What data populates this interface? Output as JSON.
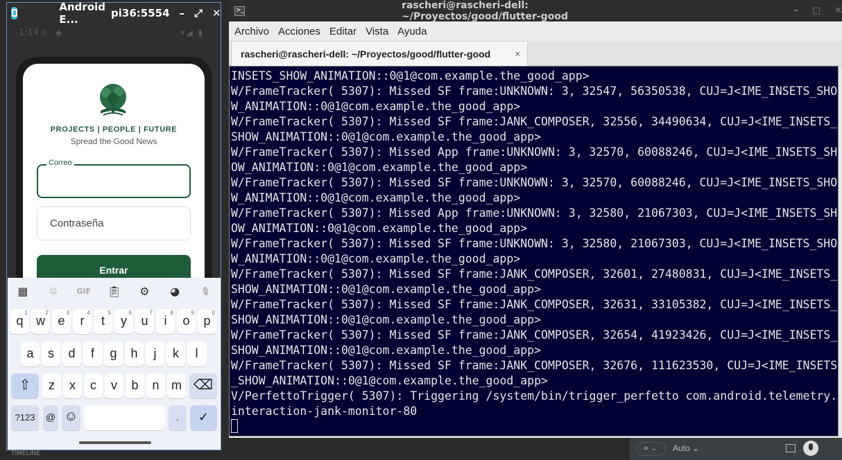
{
  "emulator": {
    "title": "Android E...",
    "device": "pi36:5554",
    "controls": {
      "minimize": "–",
      "expand": "⤢",
      "close": "✕"
    },
    "status_time": "1:14",
    "status_icons": "⊘ ◆",
    "status_right": "▾◢ ▮"
  },
  "app": {
    "slogan": "PROJECTS | PEOPLE | FUTURE",
    "tagline": "Spread the Good News",
    "email_label": "Correo",
    "email_value": "",
    "password_placeholder": "Contraseña",
    "login_button": "Entrar",
    "brand_color": "#1e5c3a"
  },
  "keyboard": {
    "toolbar": [
      "apps-icon",
      "sticker-icon",
      "GIF",
      "clipboard-icon",
      "gear-icon",
      "palette-icon",
      "mic-icon"
    ],
    "gif_label": "GIF",
    "row1": [
      {
        "k": "q",
        "h": "1"
      },
      {
        "k": "w",
        "h": "2"
      },
      {
        "k": "e",
        "h": "3"
      },
      {
        "k": "r",
        "h": "4"
      },
      {
        "k": "t",
        "h": "5"
      },
      {
        "k": "y",
        "h": "6"
      },
      {
        "k": "u",
        "h": "7"
      },
      {
        "k": "i",
        "h": "8"
      },
      {
        "k": "o",
        "h": "9"
      },
      {
        "k": "p",
        "h": "0"
      }
    ],
    "row2": [
      "a",
      "s",
      "d",
      "f",
      "g",
      "h",
      "j",
      "k",
      "l"
    ],
    "row3": [
      "z",
      "x",
      "c",
      "v",
      "b",
      "n",
      "m"
    ],
    "shift": "⇧",
    "backspace": "⌫",
    "symbols": "?123",
    "at": "@",
    "emoji": "☺",
    "period": ".",
    "enter": "✓"
  },
  "timeline_label": "TIMELINE",
  "terminal": {
    "title": "rascheri@rascheri-dell: ~/Proyectos/good/flutter-good",
    "window_controls": [
      "–",
      "□",
      "✕"
    ],
    "menu": [
      "Archivo",
      "Acciones",
      "Editar",
      "Vista",
      "Ayuda"
    ],
    "tab_label": "rascheri@rascheri-dell: ~/Proyectos/good/flutter-good",
    "tab_close": "×",
    "output": "INSETS_SHOW_ANIMATION::0@1@com.example.the_good_app>\nW/FrameTracker( 5307): Missed SF frame:UNKNOWN: 3, 32547, 56350538, CUJ=J<IME_INSETS_SHOW_ANIMATION::0@1@com.example.the_good_app>\nW/FrameTracker( 5307): Missed SF frame:JANK_COMPOSER, 32556, 34490634, CUJ=J<IME_INSETS_SHOW_ANIMATION::0@1@com.example.the_good_app>\nW/FrameTracker( 5307): Missed App frame:UNKNOWN: 3, 32570, 60088246, CUJ=J<IME_INSETS_SHOW_ANIMATION::0@1@com.example.the_good_app>\nW/FrameTracker( 5307): Missed SF frame:UNKNOWN: 3, 32570, 60088246, CUJ=J<IME_INSETS_SHOW_ANIMATION::0@1@com.example.the_good_app>\nW/FrameTracker( 5307): Missed App frame:UNKNOWN: 3, 32580, 21067303, CUJ=J<IME_INSETS_SHOW_ANIMATION::0@1@com.example.the_good_app>\nW/FrameTracker( 5307): Missed SF frame:UNKNOWN: 3, 32580, 21067303, CUJ=J<IME_INSETS_SHOW_ANIMATION::0@1@com.example.the_good_app>\nW/FrameTracker( 5307): Missed SF frame:JANK_COMPOSER, 32601, 27480831, CUJ=J<IME_INSETS_SHOW_ANIMATION::0@1@com.example.the_good_app>\nW/FrameTracker( 5307): Missed SF frame:JANK_COMPOSER, 32631, 33105382, CUJ=J<IME_INSETS_SHOW_ANIMATION::0@1@com.example.the_good_app>\nW/FrameTracker( 5307): Missed SF frame:JANK_COMPOSER, 32654, 41923426, CUJ=J<IME_INSETS_SHOW_ANIMATION::0@1@com.example.the_good_app>\nW/FrameTracker( 5307): Missed SF frame:JANK_COMPOSER, 32676, 111623530, CUJ=J<IME_INSETS_SHOW_ANIMATION::0@1@com.example.the_good_app>\nV/PerfettoTrigger( 5307): Triggering /system/bin/trigger_perfetto com.android.telemetry.interaction-jank-monitor-80\n"
  },
  "ide": {
    "control": "∞ ⌄",
    "mode": "Auto ⌄"
  }
}
